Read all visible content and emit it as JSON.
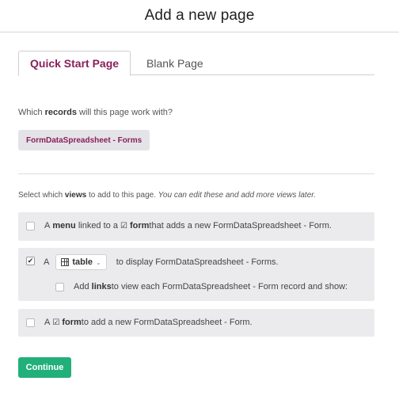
{
  "header": {
    "title": "Add a new page"
  },
  "tabs": [
    {
      "label": "Quick Start Page",
      "active": true
    },
    {
      "label": "Blank Page",
      "active": false
    }
  ],
  "records": {
    "question_prefix": "Which ",
    "question_bold": "records",
    "question_suffix": " will this page work with?",
    "selected": "FormDataSpreadsheet - Forms"
  },
  "views": {
    "question_prefix": "Select which ",
    "question_bold": "views",
    "question_mid": " to add to this page. ",
    "question_italic": "You can edit these and add more views later."
  },
  "options": {
    "menu": {
      "checked": false,
      "prefix": "A ",
      "bold1": "menu",
      "mid": " linked to a ",
      "bold2": "form",
      "suffix": " that adds a new FormDataSpreadsheet - Form."
    },
    "table": {
      "checked": true,
      "checkmark": "✔",
      "prefix": "A ",
      "select_value": "table",
      "suffix": "to display FormDataSpreadsheet - Forms.",
      "sub": {
        "checked": false,
        "prefix": "Add ",
        "bold": "links",
        "suffix": " to view each FormDataSpreadsheet - Form record and show:"
      }
    },
    "form": {
      "checked": false,
      "prefix": "A ",
      "bold": "form",
      "suffix": " to add a new FormDataSpreadsheet - Form."
    }
  },
  "continue_label": "Continue",
  "icons": {
    "form": "check-square-icon",
    "table": "table-icon",
    "dropdown": "chevron-down-icon"
  },
  "colors": {
    "accent": "#8a1f5b",
    "button": "#22b07a",
    "option_bg": "#ebebee"
  }
}
